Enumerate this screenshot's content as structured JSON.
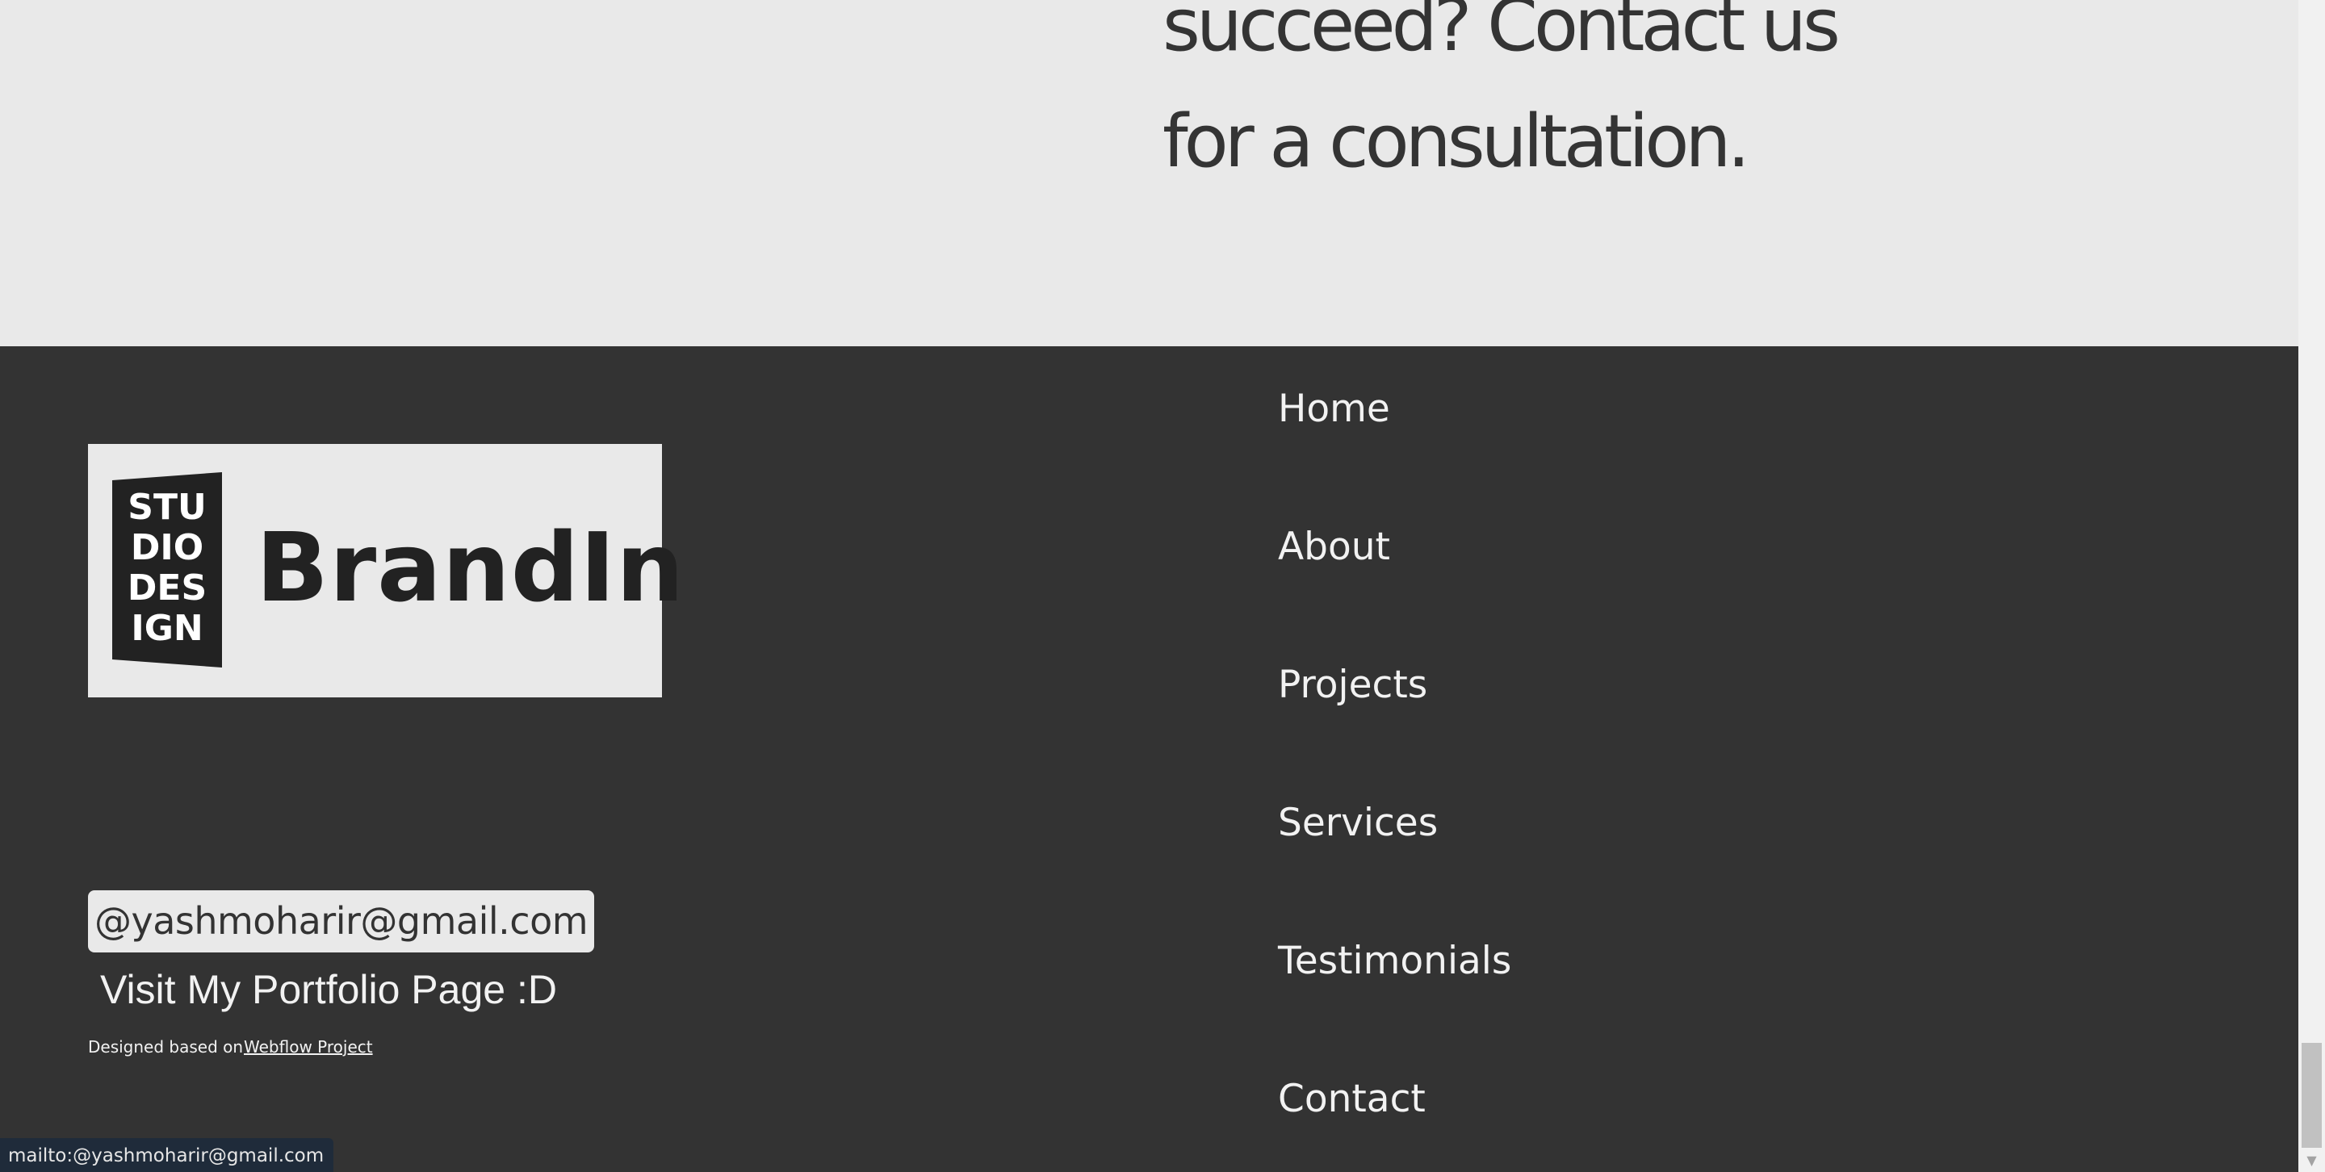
{
  "hero": {
    "heading_line1": "succeed? Contact us",
    "heading_line2": "for a consultation."
  },
  "footer": {
    "logo": {
      "mark_lines": [
        "STU",
        "DIO",
        "DES",
        "IGN"
      ],
      "brand": "BrandIn"
    },
    "email_chip": "@yashmoharir@gmail.com",
    "portfolio_link": "Visit My Portfolio Page :D",
    "credit_text": "Designed based on",
    "credit_link": "Webflow Project",
    "nav": [
      {
        "label": "Home"
      },
      {
        "label": "About"
      },
      {
        "label": "Projects"
      },
      {
        "label": "Services"
      },
      {
        "label": "Testimonials"
      },
      {
        "label": "Contact"
      }
    ]
  },
  "status_bar": {
    "url": "mailto:@yashmoharir@gmail.com"
  },
  "scrollbar": {
    "down_arrow_icon": "chevron-down-icon"
  },
  "colors": {
    "hero_bg": "#e9e9e9",
    "footer_bg": "#333333",
    "text_light": "#f2f2f2",
    "text_dark": "#343434"
  }
}
